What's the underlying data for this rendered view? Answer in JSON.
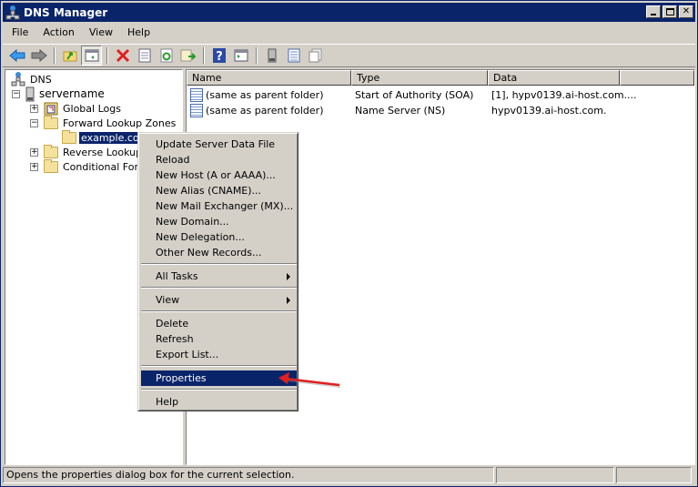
{
  "window": {
    "title": "DNS Manager",
    "controls": [
      "minimize",
      "maximize",
      "close"
    ]
  },
  "menubar": {
    "items": [
      "File",
      "Action",
      "View",
      "Help"
    ]
  },
  "toolbar": {
    "buttons": [
      "back-icon",
      "forward-icon",
      "up-folder-icon",
      "show-hide-console-tree-icon",
      "delete-icon",
      "properties-icon",
      "refresh-icon",
      "export-list-icon",
      "help-icon",
      "show-action-pane-icon",
      "server-icon",
      "list-icon",
      "copy-icon"
    ]
  },
  "tree": {
    "root": "DNS",
    "server": "servername",
    "items": [
      {
        "label": "Global Logs",
        "expander": "+"
      },
      {
        "label": "Forward Lookup Zones",
        "expander": "−"
      },
      {
        "label": "example.com",
        "selected": true
      },
      {
        "label": "Reverse Lookup Zones",
        "expander": "+"
      },
      {
        "label": "Conditional Forwarders",
        "expander": "+"
      }
    ]
  },
  "list": {
    "columns": [
      "Name",
      "Type",
      "Data",
      ""
    ],
    "rows": [
      {
        "name": "(same as parent folder)",
        "type": "Start of Authority (SOA)",
        "data": "[1], hypv0139.ai-host.com...."
      },
      {
        "name": "(same as parent folder)",
        "type": "Name Server (NS)",
        "data": "hypv0139.ai-host.com."
      }
    ]
  },
  "context_menu": {
    "items": [
      "Update Server Data File",
      "Reload",
      "New Host (A or AAAA)...",
      "New Alias (CNAME)...",
      "New Mail Exchanger (MX)...",
      "New Domain...",
      "New Delegation...",
      "Other New Records...",
      "All Tasks",
      "View",
      "Delete",
      "Refresh",
      "Export List...",
      "Properties",
      "Help"
    ],
    "highlighted": "Properties"
  },
  "annotation": {
    "arrow_color": "#e02020"
  },
  "statusbar": {
    "text": "Opens the properties dialog box for the current selection."
  }
}
